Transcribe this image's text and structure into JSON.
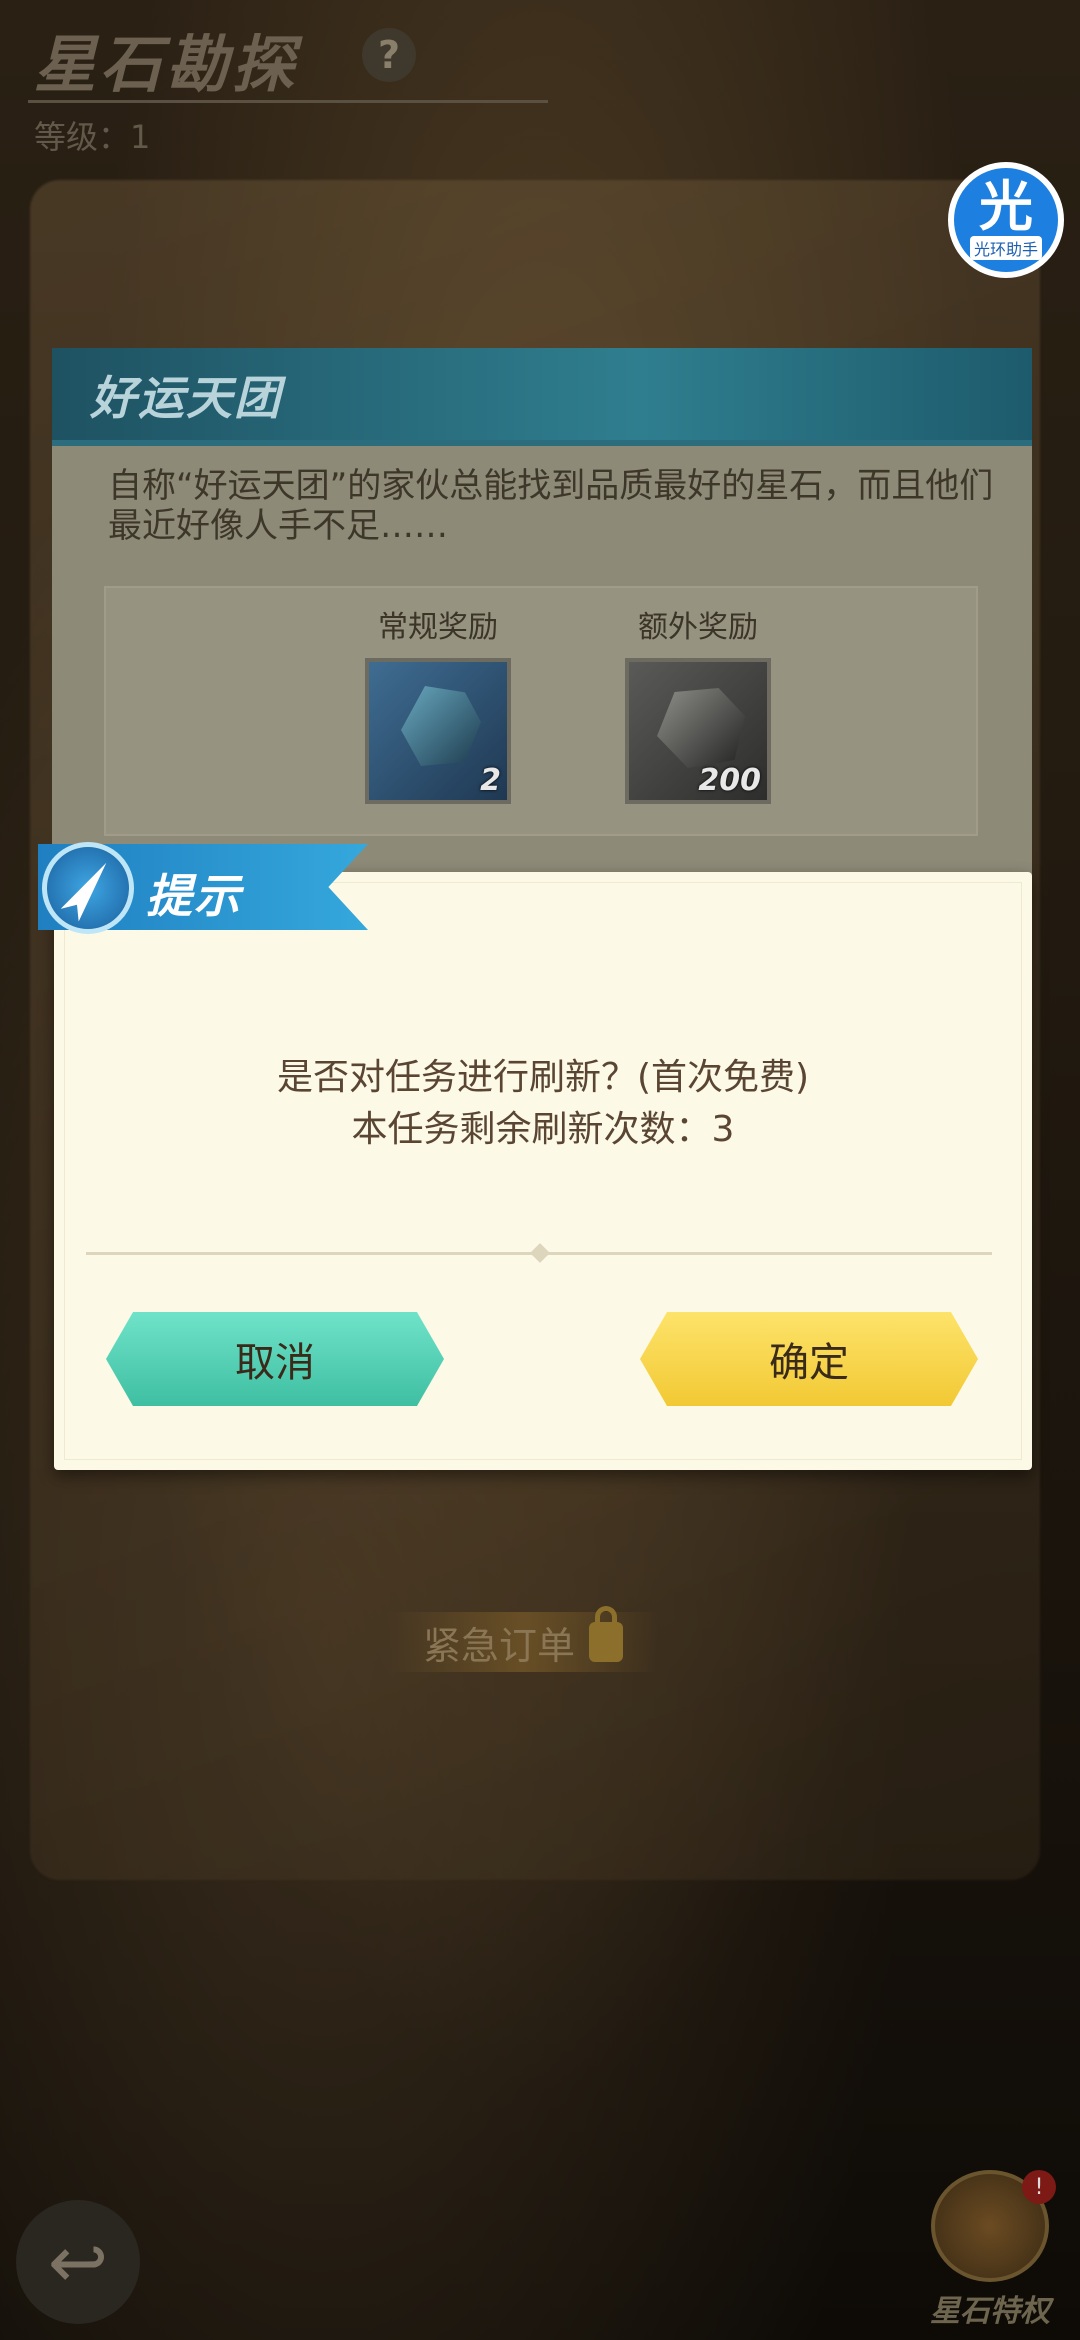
{
  "header": {
    "title": "星石勘探",
    "help_icon": "?",
    "level_text": "等级：1"
  },
  "assistant": {
    "glyph": "光",
    "label": "光环助手"
  },
  "task": {
    "title": "好运天团",
    "description": "自称“好运天团”的家伙总能找到品质最好的星石，而且他们最近好像人手不足……",
    "rewards": [
      {
        "label": "常规奖励",
        "quantity": "2",
        "icon": "blue-star-gem-icon"
      },
      {
        "label": "额外奖励",
        "quantity": "200",
        "icon": "dark-ore-icon"
      }
    ]
  },
  "dialog": {
    "title": "提示",
    "message_line1": "是否对任务进行刷新？(首次免费)",
    "message_line2": "本任务剩余刷新次数：3",
    "cancel_label": "取消",
    "confirm_label": "确定"
  },
  "background": {
    "urgent_order": "紧急订单",
    "privilege_label": "星石特权",
    "privilege_badge": "!"
  },
  "colors": {
    "cancel_button": "#4fd0b2",
    "confirm_button": "#f7d64a",
    "dialog_bg": "#fcf9e6",
    "banner_blue": "#2a93d0"
  }
}
